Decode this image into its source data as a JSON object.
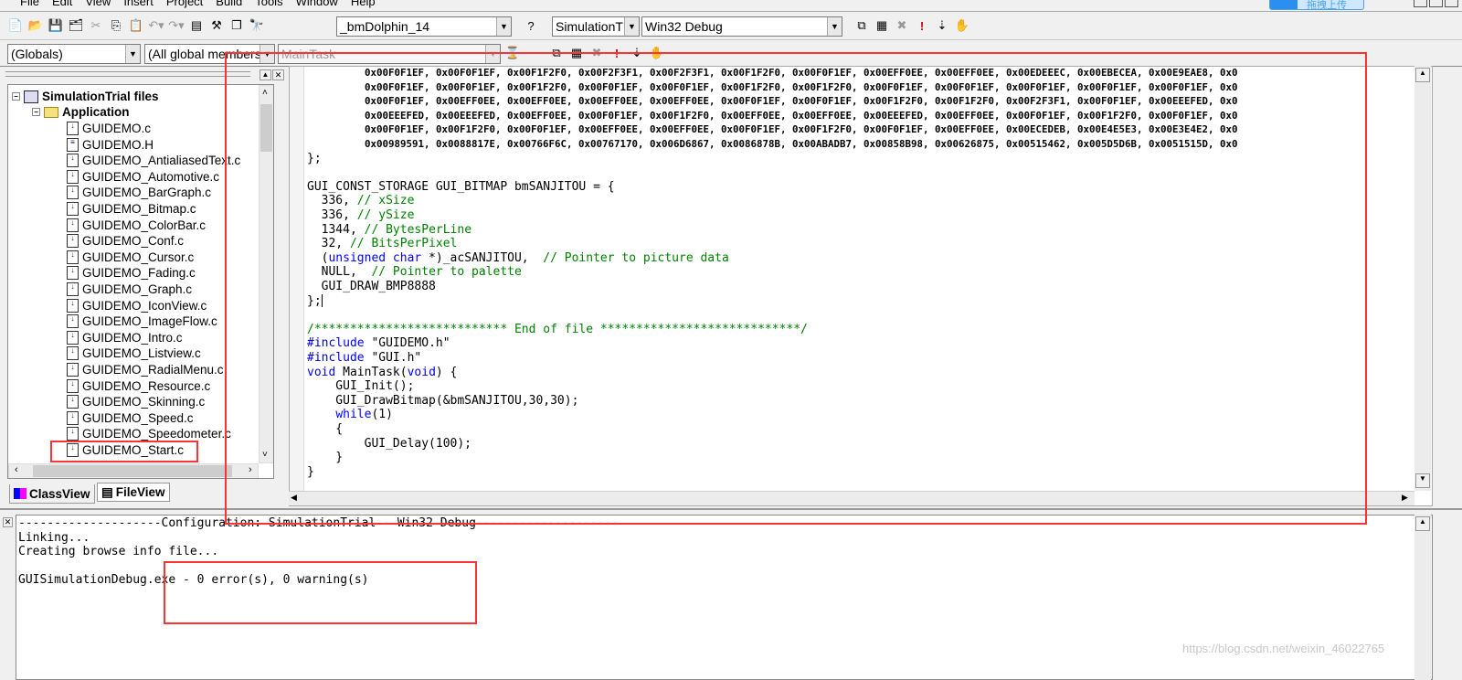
{
  "menu": [
    "File",
    "Edit",
    "View",
    "Insert",
    "Project",
    "Build",
    "Tools",
    "Window",
    "Help"
  ],
  "upload_badge": "拖拽上传",
  "toolbar": {
    "symbol_combo": "_bmDolphin_14",
    "project_combo": "SimulationT",
    "config_combo": "Win32 Debug",
    "scope_combo": "(Globals)",
    "members_combo": "(All global members",
    "function_combo": "MainTask"
  },
  "workspace": {
    "root": "SimulationTrial files",
    "folder": "Application",
    "files": [
      "GUIDEMO.c",
      "GUIDEMO.H",
      "GUIDEMO_AntialiasedText.c",
      "GUIDEMO_Automotive.c",
      "GUIDEMO_BarGraph.c",
      "GUIDEMO_Bitmap.c",
      "GUIDEMO_ColorBar.c",
      "GUIDEMO_Conf.c",
      "GUIDEMO_Cursor.c",
      "GUIDEMO_Fading.c",
      "GUIDEMO_Graph.c",
      "GUIDEMO_IconView.c",
      "GUIDEMO_ImageFlow.c",
      "GUIDEMO_Intro.c",
      "GUIDEMO_Listview.c",
      "GUIDEMO_RadialMenu.c",
      "GUIDEMO_Resource.c",
      "GUIDEMO_Skinning.c",
      "GUIDEMO_Speed.c",
      "GUIDEMO_Speedometer.c",
      "GUIDEMO_Start.c"
    ],
    "tabs": [
      "ClassView",
      "FileView"
    ]
  },
  "editor": {
    "hex_rows": [
      "0x00F0F1EF, 0x00F0F1EF, 0x00F1F2F0, 0x00F2F3F1, 0x00F2F3F1, 0x00F1F2F0, 0x00F0F1EF, 0x00EFF0EE, 0x00EFF0EE, 0x00EDEEEC, 0x00EBECEA, 0x00E9EAE8, 0x0",
      "0x00F0F1EF, 0x00F0F1EF, 0x00F1F2F0, 0x00F0F1EF, 0x00F0F1EF, 0x00F1F2F0, 0x00F1F2F0, 0x00F0F1EF, 0x00F0F1EF, 0x00F0F1EF, 0x00F0F1EF, 0x00F0F1EF, 0x0",
      "0x00F0F1EF, 0x00EFF0EE, 0x00EFF0EE, 0x00EFF0EE, 0x00EFF0EE, 0x00F0F1EF, 0x00F0F1EF, 0x00F1F2F0, 0x00F1F2F0, 0x00F2F3F1, 0x00F0F1EF, 0x00EEEFED, 0x0",
      "0x00EEEFED, 0x00EEEFED, 0x00EFF0EE, 0x00F0F1EF, 0x00F1F2F0, 0x00EFF0EE, 0x00EFF0EE, 0x00EEEFED, 0x00EFF0EE, 0x00F0F1EF, 0x00F1F2F0, 0x00F0F1EF, 0x0",
      "0x00F0F1EF, 0x00F1F2F0, 0x00F0F1EF, 0x00EFF0EE, 0x00EFF0EE, 0x00F0F1EF, 0x00F1F2F0, 0x00F0F1EF, 0x00EFF0EE, 0x00ECEDEB, 0x00E4E5E3, 0x00E3E4E2, 0x0",
      "0x00989591, 0x0088817E, 0x00766F6C, 0x00767170, 0x006D6867, 0x0086878B, 0x00ABADB7, 0x00858B98, 0x00626875, 0x00515462, 0x005D5D6B, 0x0051515D, 0x0"
    ],
    "code_lines": [
      [
        [
          "t",
          "};"
        ]
      ],
      [
        [
          "t",
          ""
        ]
      ],
      [
        [
          "t",
          "GUI_CONST_STORAGE GUI_BITMAP bmSANJITOU = {"
        ]
      ],
      [
        [
          "t",
          "  336, "
        ],
        [
          "c",
          "// xSize"
        ]
      ],
      [
        [
          "t",
          "  336, "
        ],
        [
          "c",
          "// ySize"
        ]
      ],
      [
        [
          "t",
          "  1344, "
        ],
        [
          "c",
          "// BytesPerLine"
        ]
      ],
      [
        [
          "t",
          "  32, "
        ],
        [
          "c",
          "// BitsPerPixel"
        ]
      ],
      [
        [
          "t",
          "  ("
        ],
        [
          "k",
          "unsigned char"
        ],
        [
          "t",
          " *)_acSANJITOU,  "
        ],
        [
          "c",
          "// Pointer to picture data"
        ]
      ],
      [
        [
          "t",
          "  NULL,  "
        ],
        [
          "c",
          "// Pointer to palette"
        ]
      ],
      [
        [
          "t",
          "  GUI_DRAW_BMP8888"
        ]
      ],
      [
        [
          "t",
          "};"
        ]
      ],
      [
        [
          "t",
          ""
        ]
      ],
      [
        [
          "c",
          "/*************************** End of file ****************************/"
        ]
      ],
      [
        [
          "k",
          "#include"
        ],
        [
          "t",
          " \"GUIDEMO.h\""
        ]
      ],
      [
        [
          "k",
          "#include"
        ],
        [
          "t",
          " \"GUI.h\""
        ]
      ],
      [
        [
          "k",
          "void"
        ],
        [
          "t",
          " MainTask("
        ],
        [
          "k",
          "void"
        ],
        [
          "t",
          ") {"
        ]
      ],
      [
        [
          "t",
          "    GUI_Init();"
        ]
      ],
      [
        [
          "t",
          "    GUI_DrawBitmap(&bmSANJITOU,30,30);"
        ]
      ],
      [
        [
          "t",
          "    "
        ],
        [
          "k",
          "while"
        ],
        [
          "t",
          "(1)"
        ]
      ],
      [
        [
          "t",
          "    {"
        ]
      ],
      [
        [
          "t",
          "        GUI_Delay(100);"
        ]
      ],
      [
        [
          "t",
          "    }"
        ]
      ],
      [
        [
          "t",
          "}"
        ]
      ]
    ]
  },
  "output": {
    "lines": [
      "--------------------Configuration: SimulationTrial - Win32 Debug--------------------",
      "Linking...",
      "Creating browse info file...",
      "",
      "GUISimulationDebug.exe - 0 error(s), 0 warning(s)"
    ]
  },
  "watermark": "https://blog.csdn.net/weixin_46022765",
  "colors": {
    "keyword": "#0000ff",
    "comment": "#008000",
    "annotation": "#ff3333"
  }
}
